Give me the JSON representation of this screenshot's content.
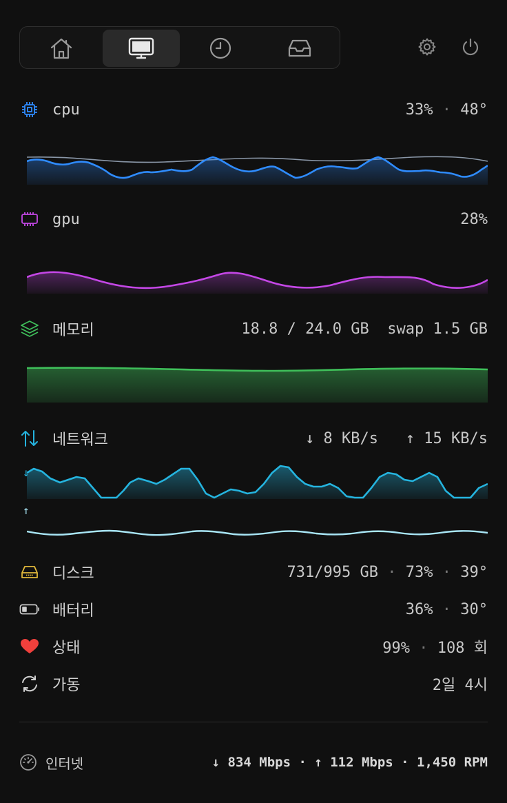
{
  "tabs": [
    {
      "icon": "home-icon",
      "active": false
    },
    {
      "icon": "monitor-icon",
      "active": true
    },
    {
      "icon": "clock-icon",
      "active": false
    },
    {
      "icon": "inbox-icon",
      "active": false
    }
  ],
  "toolbar": {
    "settings_icon": "gear-icon",
    "power_icon": "power-icon"
  },
  "cpu": {
    "label": "cpu",
    "usage": "33%",
    "temp": "48°",
    "color": "#2f8cff"
  },
  "gpu": {
    "label": "gpu",
    "usage": "28%",
    "color": "#c447e6"
  },
  "memory": {
    "label": "메모리",
    "used": "18.8 / 24.0 GB",
    "swap": "swap 1.5 GB",
    "color": "#3fbf5a"
  },
  "network": {
    "label": "네트워크",
    "down": "↓ 8 KB/s",
    "up": "↑ 15 KB/s",
    "down_glyph": "↓",
    "up_glyph": "↑",
    "color": "#25b4df",
    "up_color": "#a9e6f6"
  },
  "disk": {
    "label": "디스크",
    "used": "731/995 GB",
    "percent": "73%",
    "temp": "39°"
  },
  "battery": {
    "label": "배터리",
    "percent": "36%",
    "temp": "30°"
  },
  "health": {
    "label": "상태",
    "percent": "99%",
    "cycles": "108 회"
  },
  "uptime": {
    "label": "가동",
    "value": "2일 4시"
  },
  "internet": {
    "label": "인터넷",
    "value": "↓ 834 Mbps · ↑ 112 Mbps · 1,450 RPM"
  },
  "separator": "·"
}
